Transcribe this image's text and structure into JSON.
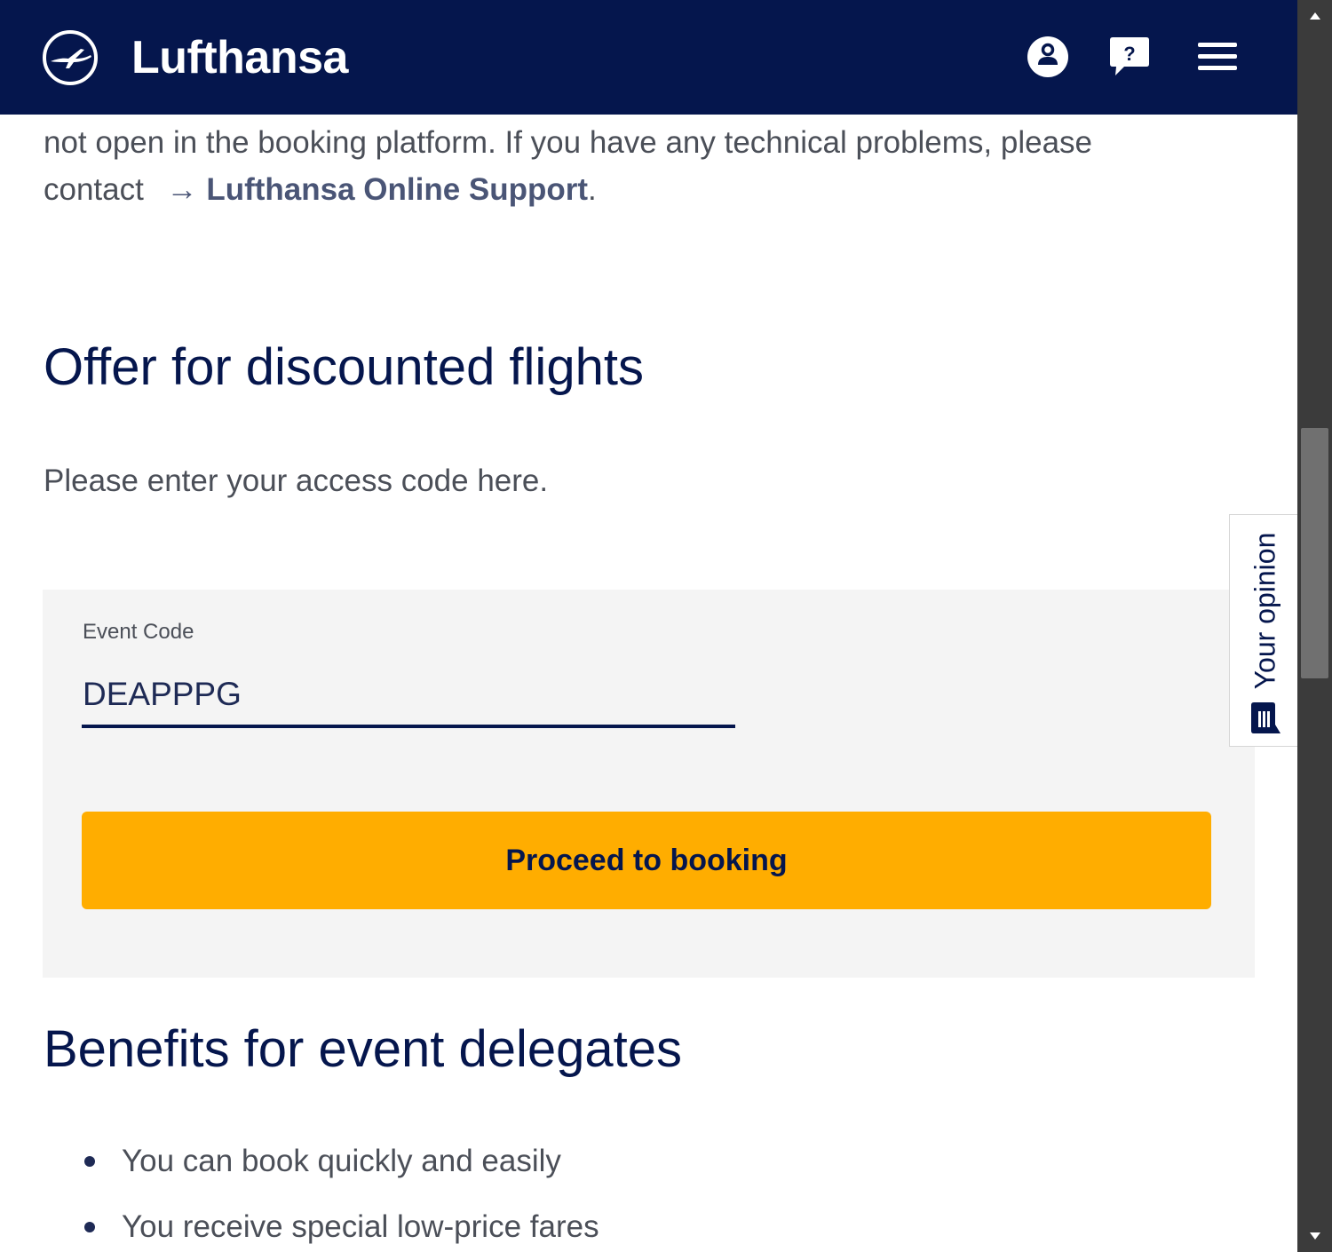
{
  "header": {
    "brand": "Lufthansa",
    "icons": {
      "logo": "crane-logo-icon",
      "account": "account-icon",
      "help": "help-icon",
      "menu": "hamburger-menu-icon"
    },
    "colors": {
      "background": "#05164d",
      "foreground": "#ffffff"
    }
  },
  "intro": {
    "text": "not open in the booking platform. If you have any technical problems, please contact",
    "link_arrow": "→",
    "link_text": "Lufthansa Online Support",
    "trailing": "."
  },
  "offer": {
    "heading": "Offer for discounted flights",
    "subtext": "Please enter your access code here."
  },
  "form": {
    "event_code_label": "Event Code",
    "event_code_value": "DEAPPPG",
    "submit_label": "Proceed to booking",
    "submit_color": "#ffad00"
  },
  "benefits": {
    "heading": "Benefits for event delegates",
    "items": [
      "You can book quickly and easily",
      "You receive special low-price fares"
    ]
  },
  "feedback_tab": {
    "label": "Your opinion",
    "icon": "feedback-icon"
  },
  "scrollbar": {
    "up_icon": "scroll-up-arrow-icon",
    "down_icon": "scroll-down-arrow-icon"
  }
}
